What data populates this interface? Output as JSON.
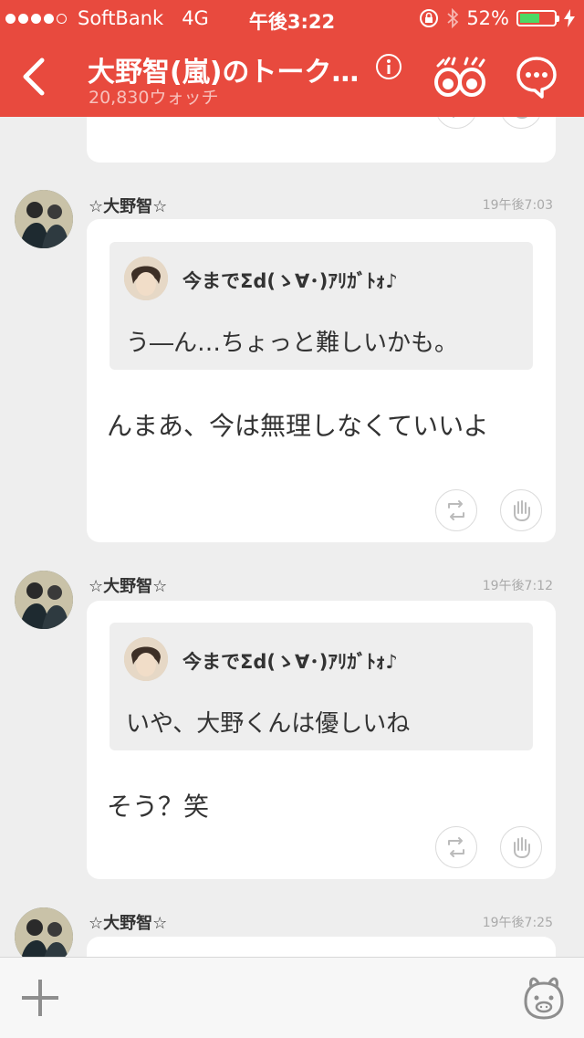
{
  "status_bar": {
    "carrier": "SoftBank",
    "network": "4G",
    "time": "午後3:22",
    "battery": "52%",
    "battery_level": 0.52,
    "signal_dots": 5,
    "signal_filled": 4
  },
  "header": {
    "title": "大野智(嵐)のトーク…",
    "watch_count": "20,830ウォッチ",
    "accent_color": "#e84a3e"
  },
  "posts": [
    {
      "author": "☆大野智☆",
      "timestamp": "19午後7:03",
      "quote": {
        "author": "今までΣd(ゝ∀･)ｱﾘｶﾞﾄｫ♪",
        "text": "う―ん…ちょっと難しいかも。"
      },
      "message": "んまあ、今は無理しなくていいよ"
    },
    {
      "author": "☆大野智☆",
      "timestamp": "19午後7:12",
      "quote": {
        "author": "今までΣd(ゝ∀･)ｱﾘｶﾞﾄｫ♪",
        "text": "いや、大野くんは優しいね"
      },
      "message": "そう？笑"
    },
    {
      "author": "☆大野智☆",
      "timestamp": "19午後7:25"
    }
  ],
  "icons": {
    "back": "chevron-left-icon",
    "info": "info-icon",
    "watch": "eyes-icon",
    "menu": "chat-bubble-more-icon",
    "repost": "repost-icon",
    "like": "hand-icon",
    "add": "plus-icon",
    "mascot": "mascot-icon"
  }
}
